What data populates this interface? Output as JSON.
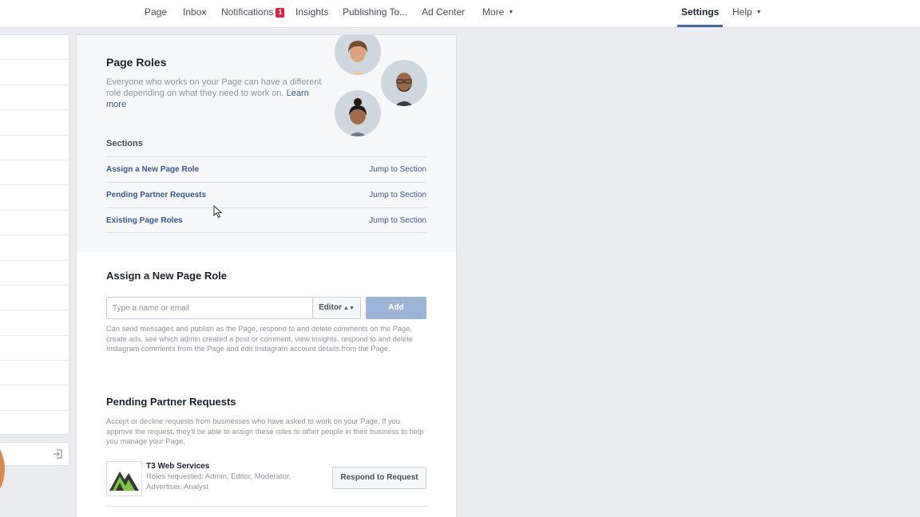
{
  "topnav": {
    "items": [
      {
        "label": "Page"
      },
      {
        "label": "Inbox"
      },
      {
        "label": "Notifications",
        "badge": "1"
      },
      {
        "label": "Insights"
      },
      {
        "label": "Publishing To..."
      },
      {
        "label": "Ad Center"
      },
      {
        "label": "More"
      }
    ],
    "settings_label": "Settings",
    "help_label": "Help",
    "caret_icon": "caret-down-icon"
  },
  "page_roles": {
    "title": "Page Roles",
    "intro": "Everyone who works on your Page can have a different role depending on what they need to work on.",
    "learn_more": "Learn more",
    "sections_label": "Sections",
    "sections": [
      {
        "name": "Assign a New Page Role",
        "jump": "Jump to Section"
      },
      {
        "name": "Pending Partner Requests",
        "jump": "Jump to Section"
      },
      {
        "name": "Existing Page Roles",
        "jump": "Jump to Section"
      }
    ]
  },
  "assign": {
    "title": "Assign a New Page Role",
    "placeholder": "Type a name or email",
    "role": "Editor",
    "add_label": "Add",
    "description": "Can send messages and publish as the Page, respond to and delete comments on the Page, create ads, see which admin created a post or comment, view insights, respond to and delete Instagram comments from the Page and edit Instagram account details from the Page."
  },
  "pending": {
    "title": "Pending Partner Requests",
    "description": "Accept or decline requests from businesses who have asked to work on your Page. If you approve the request, they'll be able to assign these roles to other people in their business to help you manage your Page.",
    "partner": {
      "name": "T3 Web Services",
      "roles": "Roles requested: Admin, Editor, Moderator, Advertiser, Analyst",
      "button": "Respond to Request"
    }
  },
  "colors": {
    "brand_blue": "#4267b2",
    "link": "#365899",
    "badge": "#e41e3f",
    "add_disabled": "#9cb4d8"
  }
}
